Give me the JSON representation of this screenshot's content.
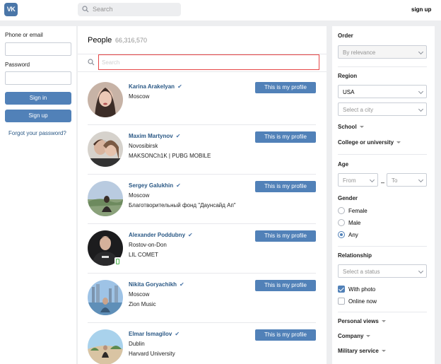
{
  "header": {
    "logo_text": "VK",
    "search_placeholder": "Search",
    "signup_label": "sign up"
  },
  "login": {
    "phone_label": "Phone or email",
    "password_label": "Password",
    "signin_label": "Sign in",
    "signup_label": "Sign up",
    "forgot_label": "Forgot your password?"
  },
  "people": {
    "title": "People",
    "count": "66,316,570",
    "search_placeholder": "Search",
    "profile_button": "This is my profile",
    "results": [
      {
        "name": "Karina Arakelyan",
        "city": "Moscow",
        "extra": ""
      },
      {
        "name": "Maxim Martynov",
        "city": "Novosibirsk",
        "extra": "MAKSONCh1K | PUBG MOBILE"
      },
      {
        "name": "Sergey Galukhin",
        "city": "Moscow",
        "extra": "Благотворительный фонд \"Даунсайд Ап\""
      },
      {
        "name": "Alexander Poddubny",
        "city": "Rostov-on-Don",
        "extra": "LIL COMET"
      },
      {
        "name": "Nikita Goryachikh",
        "city": "Moscow",
        "extra": "Zion Music"
      },
      {
        "name": "Elmar Ismagilov",
        "city": "Dublin",
        "extra": "Harvard University"
      }
    ]
  },
  "filters": {
    "order_title": "Order",
    "order_value": "By relevance",
    "region_title": "Region",
    "country_value": "USA",
    "city_placeholder": "Select a city",
    "school_label": "School",
    "college_label": "College or university",
    "age_title": "Age",
    "age_from": "From",
    "age_to": "To",
    "age_dash": "–",
    "gender_title": "Gender",
    "gender_options": [
      "Female",
      "Male",
      "Any"
    ],
    "relationship_title": "Relationship",
    "status_placeholder": "Select a status",
    "with_photo_label": "With photo",
    "online_label": "Online now",
    "personal_views_label": "Personal views",
    "company_label": "Company",
    "military_label": "Military service"
  },
  "colors": {
    "brand": "#4a76a8",
    "button": "#5181b8",
    "link": "#2a5885",
    "focus_border": "#e64646"
  }
}
